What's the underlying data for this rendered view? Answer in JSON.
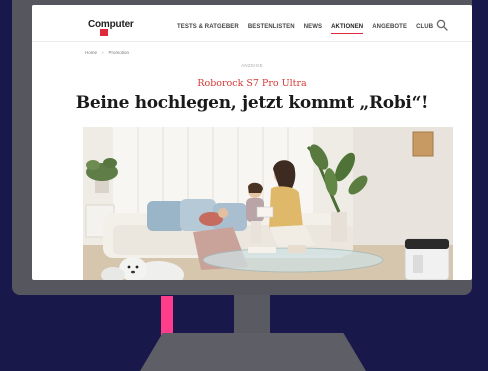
{
  "header": {
    "logo_text": "Computer",
    "nav": [
      {
        "label": "TESTS & RATGEBER"
      },
      {
        "label": "BESTENLISTEN"
      },
      {
        "label": "NEWS"
      },
      {
        "label": "AKTIONEN"
      },
      {
        "label": "ANGEBOTE"
      },
      {
        "label": "CLUB"
      }
    ],
    "search_icon": "search-icon"
  },
  "breadcrumb": [
    "Home",
    "›",
    "Promotion"
  ],
  "article": {
    "ad_label": "ANZEIGE",
    "kicker": "Roborock S7 Pro Ultra",
    "headline": "Beine hochlegen, jetzt kommt „Robi“!"
  },
  "colors": {
    "background": "#19184a",
    "monitor": "#56565e",
    "accent_red": "#e0283c",
    "cable": "#ff3d8a"
  }
}
